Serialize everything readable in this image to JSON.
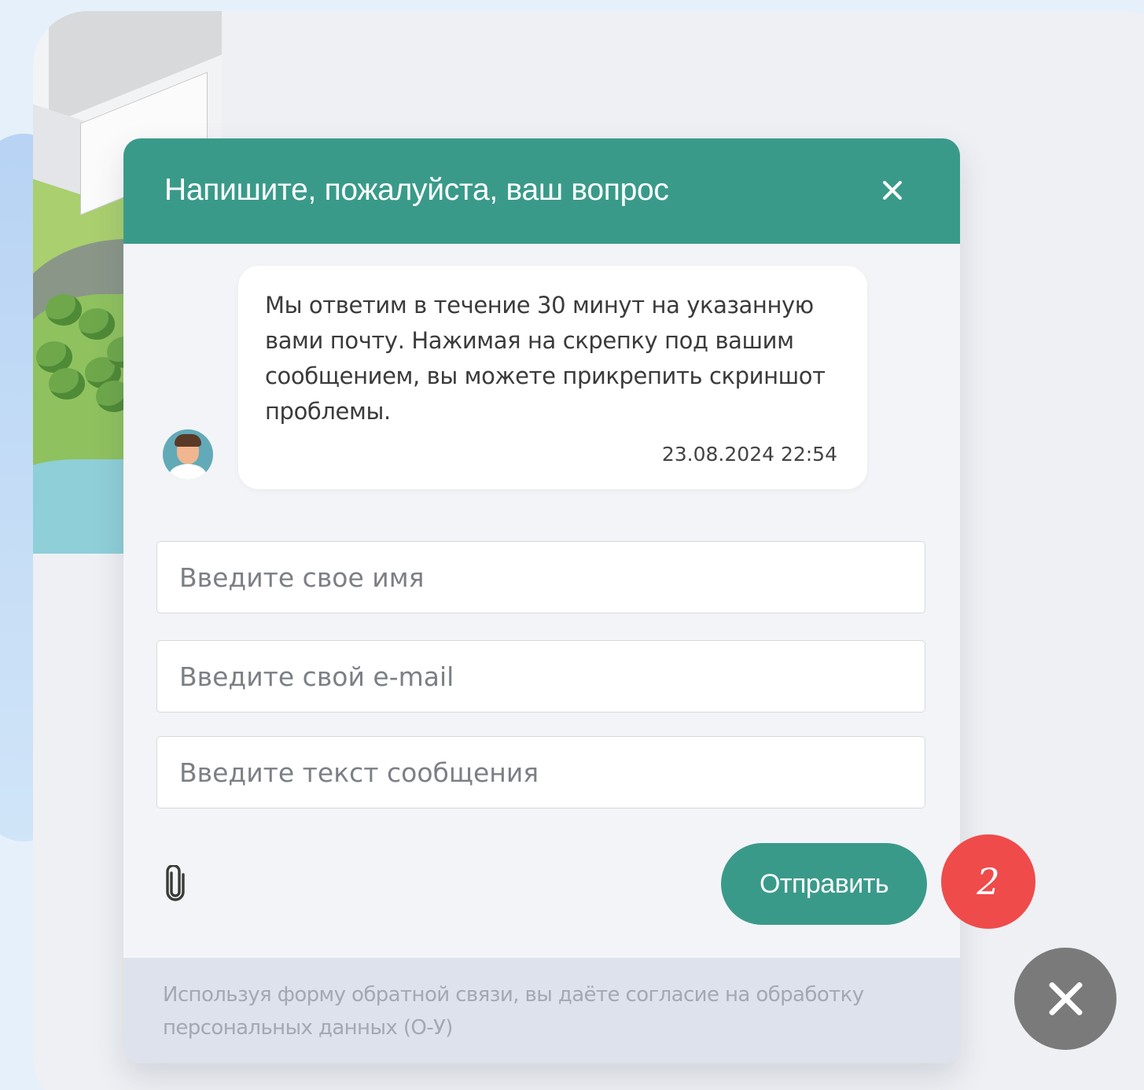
{
  "dialog": {
    "title": "Напишите, пожалуйста, ваш вопрос",
    "close_icon": "close-icon"
  },
  "message": {
    "text": "Мы ответим в течение 30 минут на указанную вами почту. Нажимая на скрепку под вашим сообщением, вы можете прикрепить скриншот проблемы.",
    "timestamp": "23.08.2024 22:54",
    "avatar_icon": "support-agent-avatar"
  },
  "form": {
    "name_placeholder": "Введите свое имя",
    "email_placeholder": "Введите свой e-mail",
    "message_placeholder": "Введите текст сообщения",
    "attach_icon": "paperclip-icon",
    "send_label": "Отправить"
  },
  "footer": {
    "consent_text": "Используя форму обратной связи, вы даёте согласие на обработку персональных данных (О-У)"
  },
  "annotation": {
    "step_number": "2"
  },
  "widget": {
    "close_icon": "close-icon"
  },
  "colors": {
    "accent": "#3a9a8a",
    "badge": "#ef4b4b",
    "widget_close": "#7a7a7a",
    "footer_bg": "#dde2ec"
  }
}
